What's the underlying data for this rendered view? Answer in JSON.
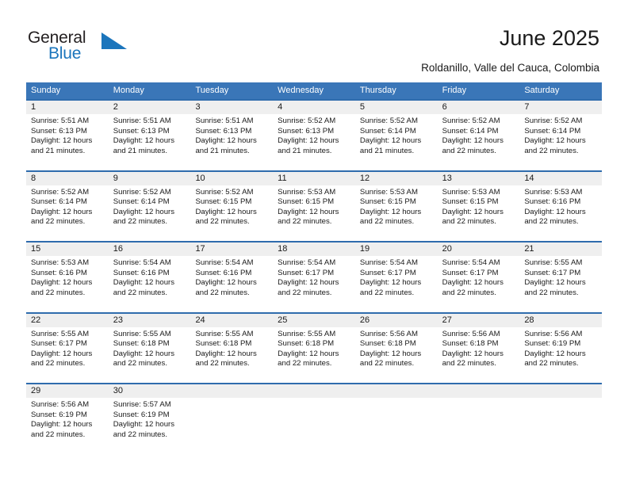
{
  "brand": {
    "name_part1": "General",
    "name_part2": "Blue",
    "accent_color": "#1b75bc"
  },
  "header": {
    "title": "June 2025",
    "subtitle": "Roldanillo, Valle del Cauca, Colombia"
  },
  "theme": {
    "header_bg": "#3a76b8",
    "row_separator": "#2f6cad",
    "daynum_bg": "#efefef",
    "text": "#1a1a1a"
  },
  "calendar": {
    "weekday_headers": [
      "Sunday",
      "Monday",
      "Tuesday",
      "Wednesday",
      "Thursday",
      "Friday",
      "Saturday"
    ],
    "weeks": [
      [
        {
          "day": "1",
          "sunrise": "Sunrise: 5:51 AM",
          "sunset": "Sunset: 6:13 PM",
          "daylight_line1": "Daylight: 12 hours",
          "daylight_line2": "and 21 minutes."
        },
        {
          "day": "2",
          "sunrise": "Sunrise: 5:51 AM",
          "sunset": "Sunset: 6:13 PM",
          "daylight_line1": "Daylight: 12 hours",
          "daylight_line2": "and 21 minutes."
        },
        {
          "day": "3",
          "sunrise": "Sunrise: 5:51 AM",
          "sunset": "Sunset: 6:13 PM",
          "daylight_line1": "Daylight: 12 hours",
          "daylight_line2": "and 21 minutes."
        },
        {
          "day": "4",
          "sunrise": "Sunrise: 5:52 AM",
          "sunset": "Sunset: 6:13 PM",
          "daylight_line1": "Daylight: 12 hours",
          "daylight_line2": "and 21 minutes."
        },
        {
          "day": "5",
          "sunrise": "Sunrise: 5:52 AM",
          "sunset": "Sunset: 6:14 PM",
          "daylight_line1": "Daylight: 12 hours",
          "daylight_line2": "and 21 minutes."
        },
        {
          "day": "6",
          "sunrise": "Sunrise: 5:52 AM",
          "sunset": "Sunset: 6:14 PM",
          "daylight_line1": "Daylight: 12 hours",
          "daylight_line2": "and 22 minutes."
        },
        {
          "day": "7",
          "sunrise": "Sunrise: 5:52 AM",
          "sunset": "Sunset: 6:14 PM",
          "daylight_line1": "Daylight: 12 hours",
          "daylight_line2": "and 22 minutes."
        }
      ],
      [
        {
          "day": "8",
          "sunrise": "Sunrise: 5:52 AM",
          "sunset": "Sunset: 6:14 PM",
          "daylight_line1": "Daylight: 12 hours",
          "daylight_line2": "and 22 minutes."
        },
        {
          "day": "9",
          "sunrise": "Sunrise: 5:52 AM",
          "sunset": "Sunset: 6:14 PM",
          "daylight_line1": "Daylight: 12 hours",
          "daylight_line2": "and 22 minutes."
        },
        {
          "day": "10",
          "sunrise": "Sunrise: 5:52 AM",
          "sunset": "Sunset: 6:15 PM",
          "daylight_line1": "Daylight: 12 hours",
          "daylight_line2": "and 22 minutes."
        },
        {
          "day": "11",
          "sunrise": "Sunrise: 5:53 AM",
          "sunset": "Sunset: 6:15 PM",
          "daylight_line1": "Daylight: 12 hours",
          "daylight_line2": "and 22 minutes."
        },
        {
          "day": "12",
          "sunrise": "Sunrise: 5:53 AM",
          "sunset": "Sunset: 6:15 PM",
          "daylight_line1": "Daylight: 12 hours",
          "daylight_line2": "and 22 minutes."
        },
        {
          "day": "13",
          "sunrise": "Sunrise: 5:53 AM",
          "sunset": "Sunset: 6:15 PM",
          "daylight_line1": "Daylight: 12 hours",
          "daylight_line2": "and 22 minutes."
        },
        {
          "day": "14",
          "sunrise": "Sunrise: 5:53 AM",
          "sunset": "Sunset: 6:16 PM",
          "daylight_line1": "Daylight: 12 hours",
          "daylight_line2": "and 22 minutes."
        }
      ],
      [
        {
          "day": "15",
          "sunrise": "Sunrise: 5:53 AM",
          "sunset": "Sunset: 6:16 PM",
          "daylight_line1": "Daylight: 12 hours",
          "daylight_line2": "and 22 minutes."
        },
        {
          "day": "16",
          "sunrise": "Sunrise: 5:54 AM",
          "sunset": "Sunset: 6:16 PM",
          "daylight_line1": "Daylight: 12 hours",
          "daylight_line2": "and 22 minutes."
        },
        {
          "day": "17",
          "sunrise": "Sunrise: 5:54 AM",
          "sunset": "Sunset: 6:16 PM",
          "daylight_line1": "Daylight: 12 hours",
          "daylight_line2": "and 22 minutes."
        },
        {
          "day": "18",
          "sunrise": "Sunrise: 5:54 AM",
          "sunset": "Sunset: 6:17 PM",
          "daylight_line1": "Daylight: 12 hours",
          "daylight_line2": "and 22 minutes."
        },
        {
          "day": "19",
          "sunrise": "Sunrise: 5:54 AM",
          "sunset": "Sunset: 6:17 PM",
          "daylight_line1": "Daylight: 12 hours",
          "daylight_line2": "and 22 minutes."
        },
        {
          "day": "20",
          "sunrise": "Sunrise: 5:54 AM",
          "sunset": "Sunset: 6:17 PM",
          "daylight_line1": "Daylight: 12 hours",
          "daylight_line2": "and 22 minutes."
        },
        {
          "day": "21",
          "sunrise": "Sunrise: 5:55 AM",
          "sunset": "Sunset: 6:17 PM",
          "daylight_line1": "Daylight: 12 hours",
          "daylight_line2": "and 22 minutes."
        }
      ],
      [
        {
          "day": "22",
          "sunrise": "Sunrise: 5:55 AM",
          "sunset": "Sunset: 6:17 PM",
          "daylight_line1": "Daylight: 12 hours",
          "daylight_line2": "and 22 minutes."
        },
        {
          "day": "23",
          "sunrise": "Sunrise: 5:55 AM",
          "sunset": "Sunset: 6:18 PM",
          "daylight_line1": "Daylight: 12 hours",
          "daylight_line2": "and 22 minutes."
        },
        {
          "day": "24",
          "sunrise": "Sunrise: 5:55 AM",
          "sunset": "Sunset: 6:18 PM",
          "daylight_line1": "Daylight: 12 hours",
          "daylight_line2": "and 22 minutes."
        },
        {
          "day": "25",
          "sunrise": "Sunrise: 5:55 AM",
          "sunset": "Sunset: 6:18 PM",
          "daylight_line1": "Daylight: 12 hours",
          "daylight_line2": "and 22 minutes."
        },
        {
          "day": "26",
          "sunrise": "Sunrise: 5:56 AM",
          "sunset": "Sunset: 6:18 PM",
          "daylight_line1": "Daylight: 12 hours",
          "daylight_line2": "and 22 minutes."
        },
        {
          "day": "27",
          "sunrise": "Sunrise: 5:56 AM",
          "sunset": "Sunset: 6:18 PM",
          "daylight_line1": "Daylight: 12 hours",
          "daylight_line2": "and 22 minutes."
        },
        {
          "day": "28",
          "sunrise": "Sunrise: 5:56 AM",
          "sunset": "Sunset: 6:19 PM",
          "daylight_line1": "Daylight: 12 hours",
          "daylight_line2": "and 22 minutes."
        }
      ],
      [
        {
          "day": "29",
          "sunrise": "Sunrise: 5:56 AM",
          "sunset": "Sunset: 6:19 PM",
          "daylight_line1": "Daylight: 12 hours",
          "daylight_line2": "and 22 minutes."
        },
        {
          "day": "30",
          "sunrise": "Sunrise: 5:57 AM",
          "sunset": "Sunset: 6:19 PM",
          "daylight_line1": "Daylight: 12 hours",
          "daylight_line2": "and 22 minutes."
        },
        {
          "day": "",
          "sunrise": "",
          "sunset": "",
          "daylight_line1": "",
          "daylight_line2": ""
        },
        {
          "day": "",
          "sunrise": "",
          "sunset": "",
          "daylight_line1": "",
          "daylight_line2": ""
        },
        {
          "day": "",
          "sunrise": "",
          "sunset": "",
          "daylight_line1": "",
          "daylight_line2": ""
        },
        {
          "day": "",
          "sunrise": "",
          "sunset": "",
          "daylight_line1": "",
          "daylight_line2": ""
        },
        {
          "day": "",
          "sunrise": "",
          "sunset": "",
          "daylight_line1": "",
          "daylight_line2": ""
        }
      ]
    ]
  }
}
